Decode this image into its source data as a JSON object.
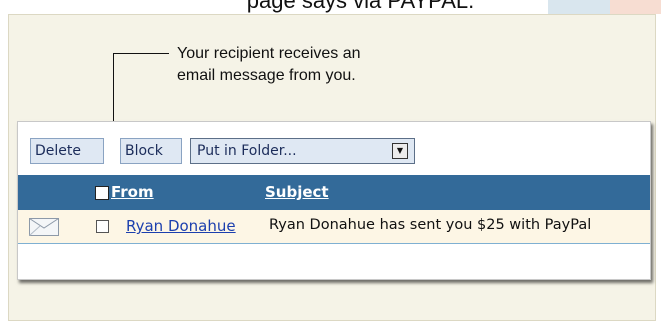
{
  "top_caption": "page says via PAYPAL.",
  "callout": {
    "line1": "Your recipient receives an",
    "line2": "email message from you."
  },
  "toolbar": {
    "delete_label": "Delete",
    "block_label": "Block",
    "folder_select_value": "Put in Folder..."
  },
  "table": {
    "columns": [
      "From",
      "Subject"
    ],
    "rows": [
      {
        "icon": "envelope-icon",
        "from": "Ryan Donahue",
        "subject": "Ryan Donahue has sent you $25 with PayPal"
      }
    ]
  },
  "colors": {
    "header_bg": "#336a99",
    "row_bg": "#fdf6e5",
    "panel_bg": "#f5f3e7",
    "link": "#1c3fae"
  }
}
